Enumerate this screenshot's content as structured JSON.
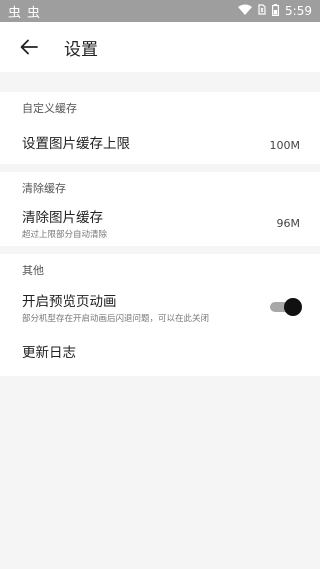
{
  "status_bar": {
    "left_icons": [
      "虫",
      "虫"
    ],
    "time": "5:59",
    "icons": [
      "wifi-icon",
      "no-sim-icon",
      "battery-icon"
    ]
  },
  "app_bar": {
    "title": "设置",
    "back_icon": "arrow-left-icon"
  },
  "sections": {
    "custom_cache": {
      "header": "自定义缓存",
      "item": {
        "title": "设置图片缓存上限",
        "value": "100M"
      }
    },
    "clear_cache": {
      "header": "清除缓存",
      "item": {
        "title": "清除图片缓存",
        "subtitle": "超过上限部分自动清除",
        "value": "96M"
      }
    },
    "other": {
      "header": "其他",
      "preview_anim": {
        "title": "开启预览页动画",
        "subtitle": "部分机型存在开启动画后闪退问题，可以在此关闭",
        "enabled": true
      },
      "changelog": {
        "title": "更新日志"
      }
    }
  }
}
